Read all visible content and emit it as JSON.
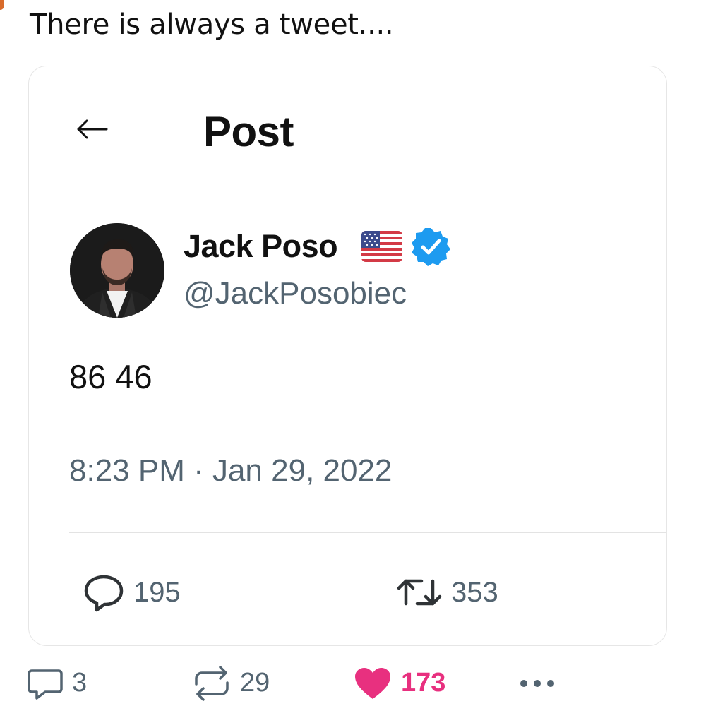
{
  "post": {
    "text": "There is always a tweet...."
  },
  "embedded_tweet": {
    "header_title": "Post",
    "author": {
      "display_name": "Jack Poso",
      "handle": "@JackPosobiec"
    },
    "body": "86 46",
    "timestamp": "8:23 PM · Jan 29, 2022",
    "metrics": {
      "replies": "195",
      "retweets": "353"
    }
  },
  "actions": {
    "comments": "3",
    "reposts": "29",
    "likes": "173",
    "like_color": "#e8307f"
  },
  "colors": {
    "verified": "#1d9bf0",
    "secondary_text": "#536471"
  }
}
